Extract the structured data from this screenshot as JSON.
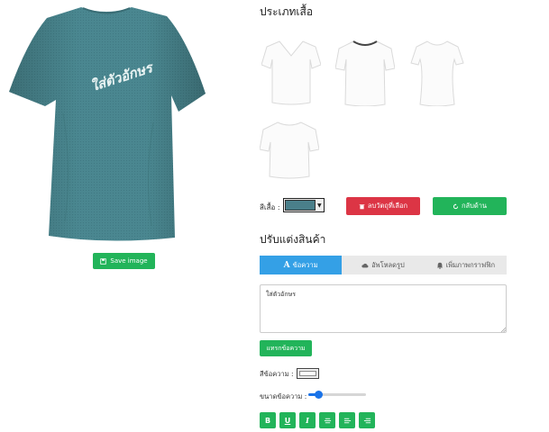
{
  "preview": {
    "shirt_color": "#4a8790",
    "overlay_text": "ใส่ตัวอักษร",
    "save_label": "Save image"
  },
  "shirt_types": {
    "heading": "ประเภทเสื้อ",
    "items": [
      {
        "name": "v-neck-shirt"
      },
      {
        "name": "crew-neck-shirt"
      },
      {
        "name": "womens-fitted-shirt"
      },
      {
        "name": "boxy-tshirt"
      }
    ]
  },
  "controls": {
    "color_label": "สีเสื้อ :",
    "selected_color": "#4a7f8a",
    "delete_label": "ลบวัตถุที่เลือก",
    "back_label": "กลับด้าน"
  },
  "customize": {
    "heading": "ปรับแต่งสินค้า",
    "tabs": [
      {
        "label": "ข้อความ",
        "icon": "font-icon",
        "active": true
      },
      {
        "label": "อัพโหลดรูป",
        "icon": "cloud-upload-icon",
        "active": false
      },
      {
        "label": "เพิ่มภาพกราฟฟิก",
        "icon": "bell-icon",
        "active": false
      }
    ],
    "text_value": "ใส่ตัวอักษร",
    "insert_label": "แทรกข้อความ",
    "text_color_label": "สีข้อความ :",
    "text_color": "#ffffff",
    "size_label": "ขนาดข้อความ :",
    "size_fraction": 0.12,
    "format_buttons": [
      {
        "label": "B",
        "name": "bold-button"
      },
      {
        "label": "U",
        "name": "underline-button"
      },
      {
        "label": "I",
        "name": "italic-button"
      },
      {
        "label": "",
        "name": "align-center-button",
        "icon": "align-center-icon"
      },
      {
        "label": "",
        "name": "align-left-button",
        "icon": "align-left-icon"
      },
      {
        "label": "",
        "name": "align-right-button",
        "icon": "align-right-icon"
      }
    ]
  },
  "colors": {
    "green": "#22b45a",
    "red": "#dc3545",
    "blue": "#34a0e6"
  }
}
